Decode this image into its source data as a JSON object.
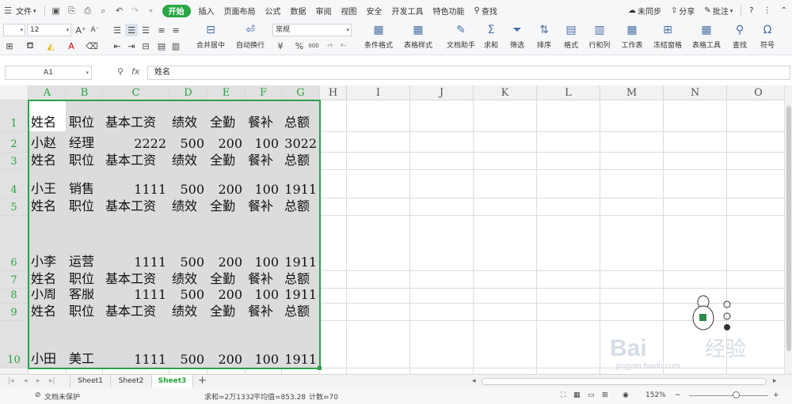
{
  "menubar": {
    "file": "文件",
    "tabs": [
      "开始",
      "插入",
      "页面布局",
      "公式",
      "数据",
      "审阅",
      "视图",
      "安全",
      "开发工具",
      "特色功能"
    ],
    "active_tab": "开始",
    "search": "查找",
    "sync": "未同步",
    "share": "分享",
    "comment": "批注",
    "help": "?"
  },
  "ribbon": {
    "font_size": "12",
    "merge_center": "合并居中",
    "wrap_text": "自动换行",
    "number_format": "常规",
    "percent": "%",
    "thousands": "000",
    "conditional_format": "条件格式",
    "table_style": "表格样式",
    "doc_assistant": "文档助手",
    "sum": "求和",
    "filter": "筛选",
    "sort": "排序",
    "format": "格式",
    "row_col": "行和列",
    "worksheet": "工作表",
    "freeze": "冻结窗格",
    "table_tools": "表格工具",
    "find": "查找",
    "symbol": "符号"
  },
  "formula_bar": {
    "name_box": "A1",
    "fx": "fx",
    "content": "姓名"
  },
  "columns": [
    "A",
    "B",
    "C",
    "D",
    "E",
    "F",
    "G",
    "H",
    "I",
    "J",
    "K",
    "L",
    "M",
    "N",
    "O"
  ],
  "rows": [
    {
      "num": "1",
      "cells": [
        "姓名",
        "职位",
        "基本工资",
        "绩效",
        "全勤",
        "餐补",
        "总额"
      ]
    },
    {
      "num": "2",
      "cells": [
        "小赵",
        "经理",
        "2222",
        "500",
        "200",
        "100",
        "3022"
      ]
    },
    {
      "num": "3",
      "cells": [
        "姓名",
        "职位",
        "基本工资",
        "绩效",
        "全勤",
        "餐补",
        "总额"
      ]
    },
    {
      "num": "4",
      "cells": [
        "小王",
        "销售",
        "1111",
        "500",
        "200",
        "100",
        "1911"
      ]
    },
    {
      "num": "5",
      "cells": [
        "姓名",
        "职位",
        "基本工资",
        "绩效",
        "全勤",
        "餐补",
        "总额"
      ]
    },
    {
      "num": "6",
      "cells": [
        "小李",
        "运营",
        "1111",
        "500",
        "200",
        "100",
        "1911"
      ]
    },
    {
      "num": "7",
      "cells": [
        "姓名",
        "职位",
        "基本工资",
        "绩效",
        "全勤",
        "餐补",
        "总额"
      ]
    },
    {
      "num": "8",
      "cells": [
        "小周",
        "客服",
        "1111",
        "500",
        "200",
        "100",
        "1911"
      ]
    },
    {
      "num": "9",
      "cells": [
        "姓名",
        "职位",
        "基本工资",
        "绩效",
        "全勤",
        "餐补",
        "总额"
      ]
    },
    {
      "num": "10",
      "cells": [
        "小田",
        "美工",
        "1111",
        "500",
        "200",
        "100",
        "1911"
      ]
    }
  ],
  "sheets": [
    "Sheet1",
    "Sheet2",
    "Sheet3"
  ],
  "active_sheet": "Sheet3",
  "status": {
    "protect": "文档未保护",
    "sum": "求和=2万1332",
    "avg": "平均值=853.28",
    "count": "计数=70",
    "zoom": "152%"
  },
  "watermark": {
    "brand": "Bai",
    "brand2": "经验",
    "url": "jingyan.baidu.com"
  },
  "colors": {
    "accent": "#27a845",
    "selection": "#2aa14a",
    "header_bg": "#f2f2f2",
    "selected_cells": "#dcdcdc"
  }
}
